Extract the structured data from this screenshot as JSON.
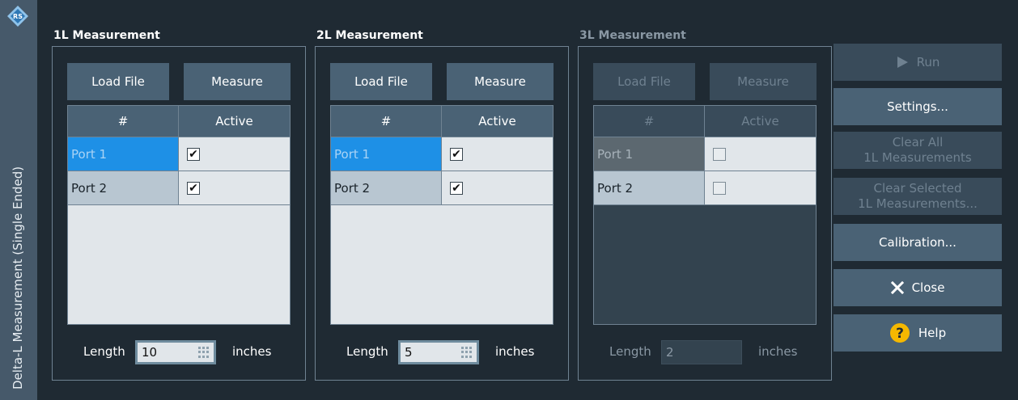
{
  "window": {
    "title": "Delta-L Measurement   (Single Ended)"
  },
  "groups": [
    {
      "title": "1L Measurement",
      "load_file": "Load File",
      "measure": "Measure",
      "columns": [
        "#",
        "Active"
      ],
      "rows": [
        {
          "port": "Port 1",
          "active": "✔",
          "selected": true
        },
        {
          "port": "Port 2",
          "active": "✔",
          "selected": false
        }
      ],
      "length_label": "Length",
      "length_value": "10",
      "unit": "inches",
      "enabled": true
    },
    {
      "title": "2L Measurement",
      "load_file": "Load File",
      "measure": "Measure",
      "columns": [
        "#",
        "Active"
      ],
      "rows": [
        {
          "port": "Port 1",
          "active": "✔",
          "selected": true
        },
        {
          "port": "Port 2",
          "active": "✔",
          "selected": false
        }
      ],
      "length_label": "Length",
      "length_value": "5",
      "unit": "inches",
      "enabled": true
    },
    {
      "title": "3L Measurement",
      "load_file": "Load File",
      "measure": "Measure",
      "columns": [
        "#",
        "Active"
      ],
      "rows": [
        {
          "port": "Port 1",
          "active": "",
          "selected": true
        },
        {
          "port": "Port 2",
          "active": "",
          "selected": false
        }
      ],
      "length_label": "Length",
      "length_value": "2",
      "unit": "inches",
      "enabled": false
    }
  ],
  "actions": {
    "run": "Run",
    "settings": "Settings...",
    "clear_all_line1": "Clear All",
    "clear_all_line2": "1L Measurements",
    "clear_selected_line1": "Clear Selected",
    "clear_selected_line2": "1L Measurements...",
    "calibration": "Calibration...",
    "close": "Close",
    "help": "Help"
  },
  "icons": {
    "logo": "rohde-schwarz-logo",
    "run": "play-icon",
    "close": "close-x-icon",
    "help": "help-question-icon",
    "keyboard": "keypad-icon"
  },
  "colors": {
    "background": "#1f2a33",
    "button": "#4a6275",
    "selection": "#1e90e6",
    "help_icon": "#f5b800"
  }
}
